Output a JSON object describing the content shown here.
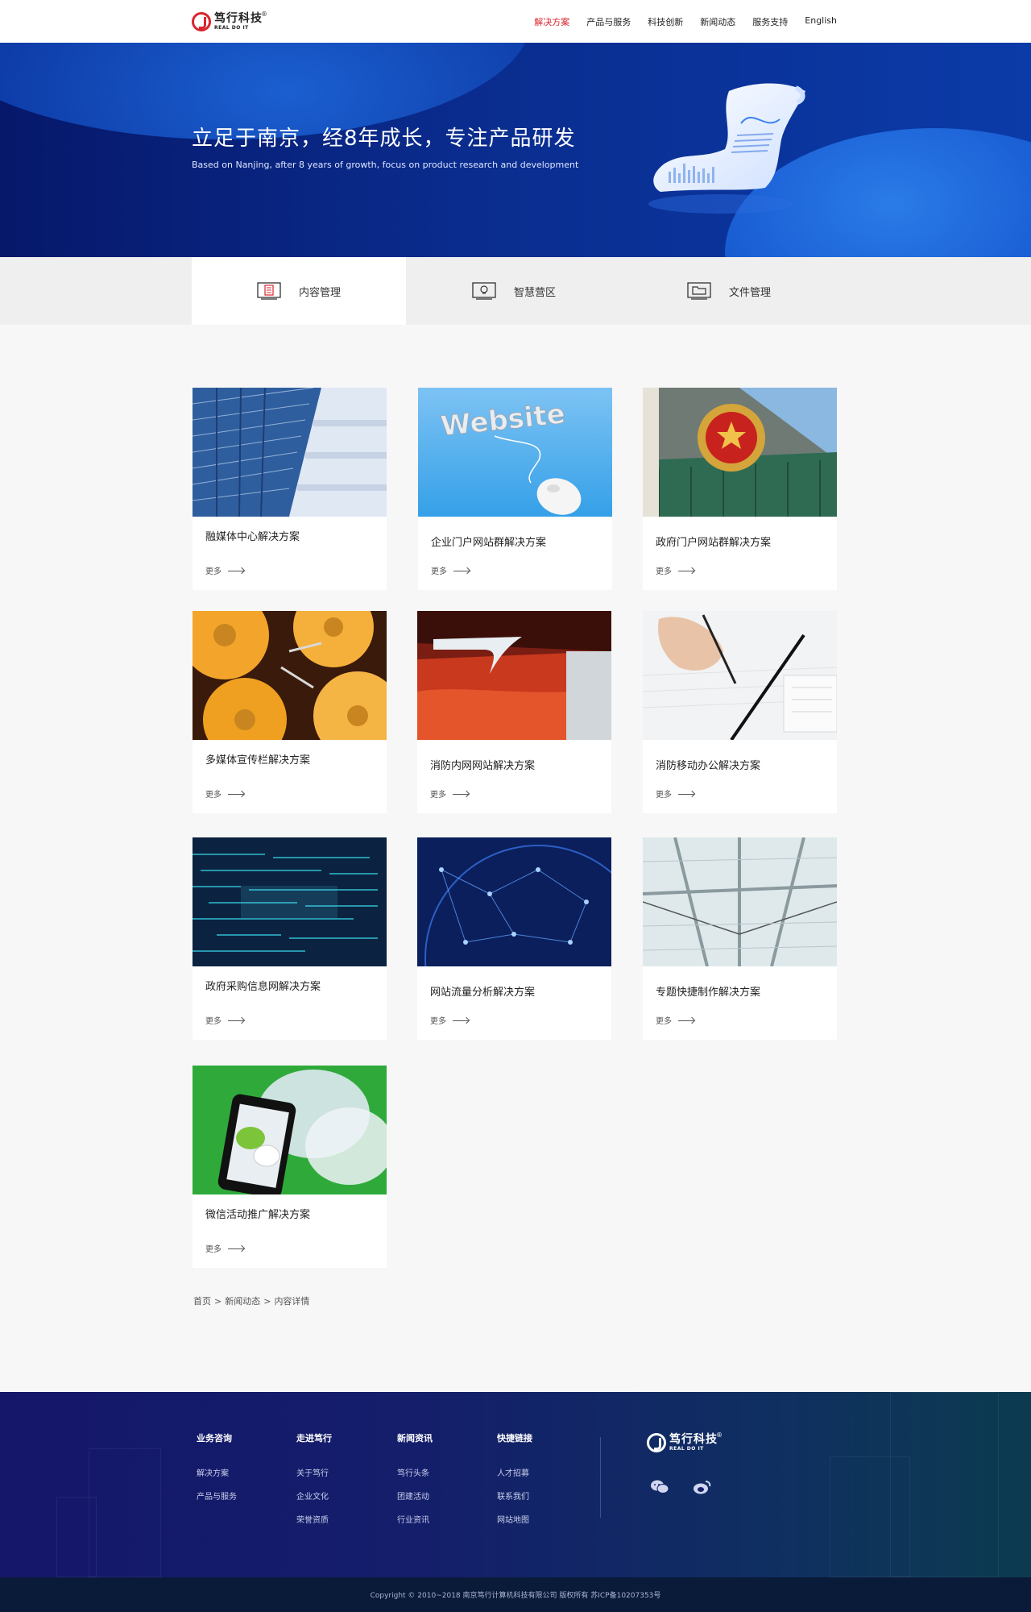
{
  "header": {
    "logo": {
      "cn": "笃行科技",
      "en": "REAL DO IT",
      "reg": "®"
    },
    "nav": [
      {
        "label": "解决方案",
        "active": true
      },
      {
        "label": "产品与服务",
        "active": false
      },
      {
        "label": "科技创新",
        "active": false
      },
      {
        "label": "新闻动态",
        "active": false
      },
      {
        "label": "服务支持",
        "active": false
      },
      {
        "label": "English",
        "active": false
      }
    ]
  },
  "banner": {
    "title": "立足于南京，经8年成长，专注产品研发",
    "subtitle": "Based on Nanjing, after 8 years of growth, focus on product research and development"
  },
  "tabs": [
    {
      "label": "内容管理",
      "icon": "content-management-icon",
      "active": true
    },
    {
      "label": "智慧营区",
      "icon": "lightbulb-icon",
      "active": false
    },
    {
      "label": "文件管理",
      "icon": "folder-icon",
      "active": false
    }
  ],
  "cards": [
    {
      "title": "融媒体中心解决方案",
      "more": "更多",
      "image": "building-image"
    },
    {
      "title": "企业门户网站群解决方案",
      "more": "更多",
      "image": "website-mouse-image"
    },
    {
      "title": "政府门户网站群解决方案",
      "more": "更多",
      "image": "national-emblem-image"
    },
    {
      "title": "多媒体宣传栏解决方案",
      "more": "更多",
      "image": "hard-drive-image"
    },
    {
      "title": "消防内网网站解决方案",
      "more": "更多",
      "image": "fire-truck-image"
    },
    {
      "title": "消防移动办公解决方案",
      "more": "更多",
      "image": "writing-hand-image"
    },
    {
      "title": "政府采购信息网解决方案",
      "more": "更多",
      "image": "code-stream-image"
    },
    {
      "title": "网站流量分析解决方案",
      "more": "更多",
      "image": "network-globe-image"
    },
    {
      "title": "专题快捷制作解决方案",
      "more": "更多",
      "image": "glass-roof-image"
    },
    {
      "title": "微信活动推广解决方案",
      "more": "更多",
      "image": "wechat-phone-image"
    }
  ],
  "breadcrumb": {
    "items": [
      "首页",
      "新闻动态",
      "内容详情"
    ],
    "separator": ">"
  },
  "footer": {
    "columns": [
      {
        "heading": "业务咨询",
        "links": [
          "解决方案",
          "产品与服务"
        ]
      },
      {
        "heading": "走进笃行",
        "links": [
          "关于笃行",
          "企业文化",
          "荣誉资质"
        ]
      },
      {
        "heading": "新闻资讯",
        "links": [
          "笃行头条",
          "团建活动",
          "行业资讯"
        ]
      },
      {
        "heading": "快捷链接",
        "links": [
          "人才招募",
          "联系我们",
          "网站地图"
        ]
      }
    ],
    "social": [
      "wechat-icon",
      "weibo-icon"
    ],
    "copyright": "Copyright © 2010~2018 南京笃行计算机科技有限公司 版权所有 苏ICP备10207353号"
  },
  "colors": {
    "accent": "#d9252f",
    "banner": "#0a2c8e",
    "footer": "#15176a"
  }
}
